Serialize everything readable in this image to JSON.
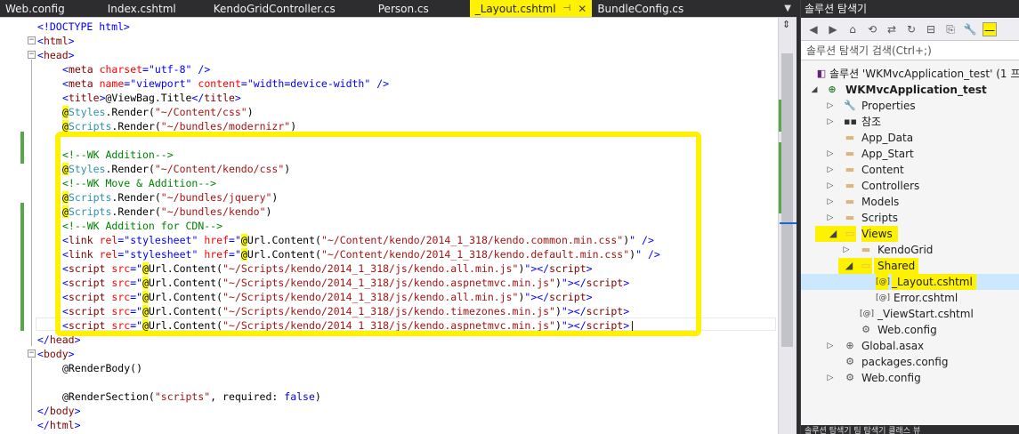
{
  "tabs": [
    {
      "label": "Web.config"
    },
    {
      "label": "Index.cshtml"
    },
    {
      "label": "KendoGridController.cs"
    },
    {
      "label": "Person.cs"
    },
    {
      "label": "_Layout.cshtml"
    },
    {
      "label": "BundleConfig.cs"
    }
  ],
  "panel": {
    "title": "솔루션 탐색기",
    "search_placeholder": "솔루션 탐색기 검색(Ctrl+;)",
    "bottom_tabs": "솔루션 탐색기   팀 탐색기   클래스 뷰"
  },
  "tree": [
    {
      "label": "솔루션 'WKMvcApplication_test' (1 프로"
    },
    {
      "label": "WKMvcApplication_test"
    },
    {
      "label": "Properties"
    },
    {
      "label": "참조"
    },
    {
      "label": "App_Data"
    },
    {
      "label": "App_Start"
    },
    {
      "label": "Content"
    },
    {
      "label": "Controllers"
    },
    {
      "label": "Models"
    },
    {
      "label": "Scripts"
    },
    {
      "label": "Views"
    },
    {
      "label": "KendoGrid"
    },
    {
      "label": "Shared"
    },
    {
      "label": "_Layout.cshtml"
    },
    {
      "label": "Error.cshtml"
    },
    {
      "label": "_ViewStart.cshtml"
    },
    {
      "label": "Web.config"
    },
    {
      "label": "Global.asax"
    },
    {
      "label": "packages.config"
    },
    {
      "label": "Web.config"
    }
  ],
  "code": {
    "l1": "<!DOCTYPE html>",
    "l2": "html",
    "l3": "head",
    "l4_attr1": "charset",
    "l4_val1": "\"utf-8\"",
    "l5_attr1": "name",
    "l5_val1": "\"viewport\"",
    "l5_attr2": "content",
    "l5_val2": "\"width=device-width\"",
    "l6_inner": "@ViewBag.Title",
    "l7_obj": "Styles",
    "l7_rest": ".Render(",
    "l7_str": "\"~/Content/css\"",
    "l8_obj": "Scripts",
    "l8_rest": ".Render(",
    "l8_str": "\"~/bundles/modernizr\"",
    "l10": "<!--WK Addition-->",
    "l11_obj": "Styles",
    "l11_rest": ".Render(",
    "l11_str": "\"~/Content/kendo/css\"",
    "l12": "<!--WK Move & Addition-->",
    "l13_obj": "Scripts",
    "l13_rest": ".Render(",
    "l13_str": "\"~/bundles/jquery\"",
    "l14_obj": "Scripts",
    "l14_rest": ".Render(",
    "l14_str": "\"~/bundles/kendo\"",
    "l15": "<!--WK Addition for CDN-->",
    "l16_path": "\"~/Content/kendo/2014_1_318/kendo.common.min.css\"",
    "l17_path": "\"~/Content/kendo/2014_1_318/kendo.default.min.css\"",
    "l18_path": "\"~/Scripts/kendo/2014_1_318/js/kendo.all.min.js\"",
    "l19_path": "\"~/Scripts/kendo/2014_1_318/js/kendo.aspnetmvc.min.js\"",
    "l20_path": "\"~/Scripts/kendo/2014_1_318/js/kendo.all.min.js\"",
    "l21_path": "\"~/Scripts/kendo/2014_1_318/js/kendo.timezones.min.js\"",
    "l22_path": "\"~/Scripts/kendo/2014_1_318/js/kendo.aspnetmvc.min.js\"",
    "l23": "head",
    "l24": "body",
    "l25": "@RenderBody()",
    "l27_call": "@RenderSection(",
    "l27_str": "\"scripts\"",
    "l27_mid": ", required: ",
    "l27_kw": "false",
    "l27_end": ")",
    "l28": "body",
    "l29": "html"
  },
  "colors": {
    "highlight": "#fff200",
    "selection": "#cce8ff",
    "change_marker": "#57a64a"
  }
}
